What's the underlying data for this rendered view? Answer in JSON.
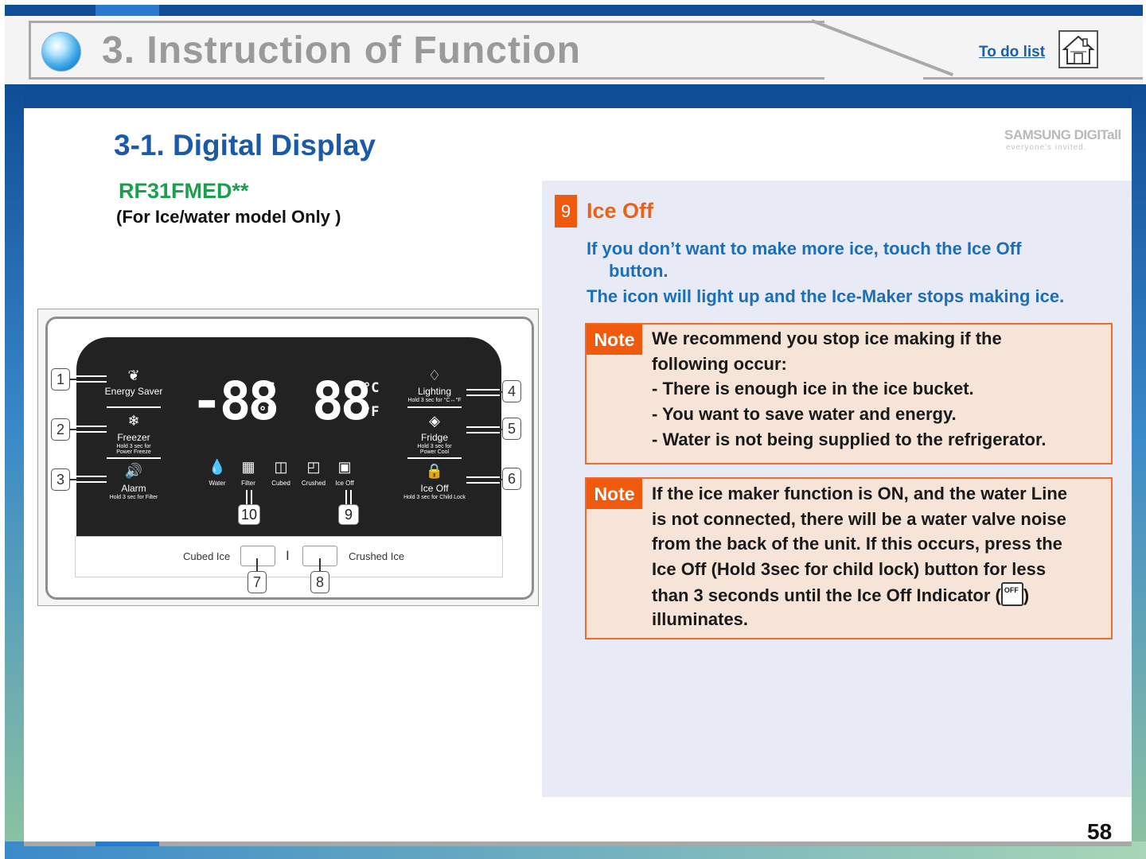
{
  "header": {
    "title": "3. Instruction of Function",
    "todo_link": "To do list",
    "home_icon": "home-icon"
  },
  "brand": {
    "logo": "SAMSUNG DIGITall",
    "tagline": "everyone's invited."
  },
  "section": {
    "title": "3-1. Digital Display",
    "model": "RF31FMED**",
    "model_note": "(For Ice/water model Only )"
  },
  "panel": {
    "left_buttons": [
      {
        "number": "1",
        "label": "Energy Saver",
        "sub": ""
      },
      {
        "number": "2",
        "label": "Freezer",
        "sub1": "Hold 3 sec for",
        "sub2": "Power Freeze"
      },
      {
        "number": "3",
        "label": "Alarm",
        "sub1": "Hold 3 sec for Filter",
        "sub2": ""
      }
    ],
    "right_buttons": [
      {
        "number": "4",
        "label": "Lighting",
        "sub1": "Hold 3 sec for °C↔°F",
        "sub2": ""
      },
      {
        "number": "5",
        "label": "Fridge",
        "sub1": "Hold 3 sec for",
        "sub2": "Power Cool"
      },
      {
        "number": "6",
        "label": "Ice Off",
        "sub1": "Hold 3 sec for Child Lock",
        "sub2": ""
      }
    ],
    "temp_left": "-88",
    "temp_right": "88",
    "unit_c": "°C",
    "unit_f": "°F",
    "dispenser_icons": [
      "Water",
      "Filter",
      "Cubed",
      "Crushed",
      "Ice Off"
    ],
    "callout_10": "10",
    "callout_9": "9",
    "cubed_ice": "Cubed Ice",
    "divider": "I",
    "crushed_ice": "Crushed Ice",
    "callout_7": "7",
    "callout_8": "8"
  },
  "info": {
    "badge": "9",
    "title": "Ice Off",
    "desc_line1": "If you don’t want to make more ice, touch the Ice Off",
    "desc_line2": "button.",
    "desc_line3": "The icon will light up and the Ice-Maker stops making ice.",
    "note_label": "Note",
    "note1": [
      "We recommend you stop ice making if the",
      "following occur:",
      "- There is enough ice in the ice bucket.",
      "- You want to save water and energy.",
      "- Water is not being supplied to the refrigerator."
    ],
    "note2": [
      "If the ice maker function is ON, and the water Line",
      "is not connected, there will be a water valve noise",
      "from the back of the unit. If this occurs, press the",
      "Ice Off (Hold 3sec for child lock) button for less",
      "than 3 seconds until the Ice Off Indicator (",
      ")",
      "illuminates."
    ],
    "indicator_text": "OFF"
  },
  "footer": {
    "page_number": "58"
  },
  "colors": {
    "brand_blue": "#0f4d97",
    "title_blue": "#1b5aa6",
    "model_green": "#1aa04c",
    "accent_orange": "#f05a0f",
    "note_bg": "#f6e4d8",
    "panel_bg": "#e8eaf6"
  }
}
